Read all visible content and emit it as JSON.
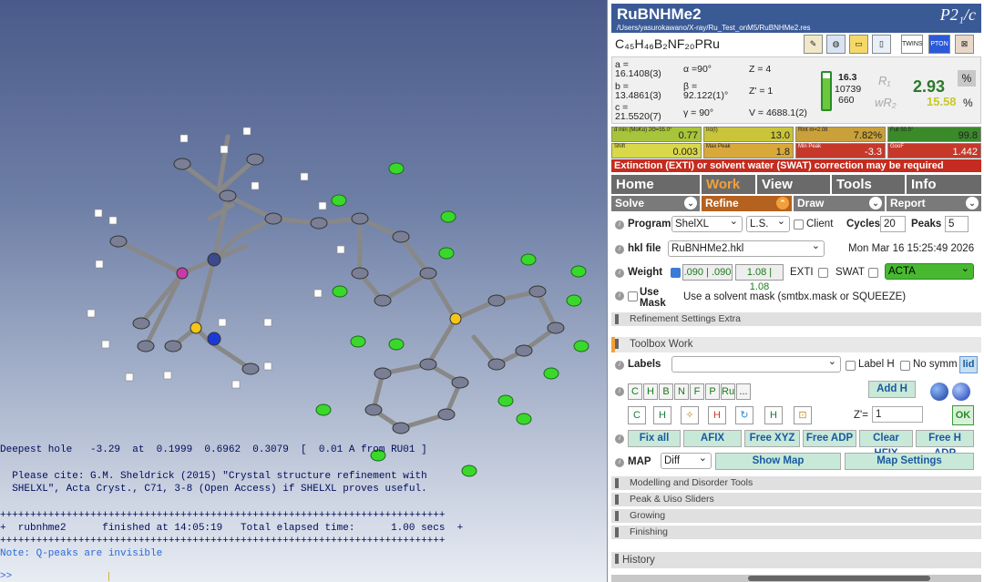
{
  "console": {
    "deepest": "Deepest hole   -3.29  at  0.1999  0.6962  0.3079  [  0.01 A from RU01 ]",
    "cite1": "  Please cite: G.M. Sheldrick (2015) \"Crystal structure refinement with",
    "cite2": "  SHELXL\", Acta Cryst., C71, 3-8 (Open Access) if SHELXL proves useful.",
    "plus1": "++++++++++++++++++++++++++++++++++++++++++++++++++++++++++++++++++++++++++",
    "finish": "+  rubnhme2      finished at 14:05:19   Total elapsed time:      1.00 secs  +",
    "plus2": "++++++++++++++++++++++++++++++++++++++++++++++++++++++++++++++++++++++++++",
    "note": "Note: Q-peaks are invisible",
    "prompt": ">>"
  },
  "header": {
    "title": "RuBNHMe2",
    "path": "/Users/yasurokawano/X-ray/Ru_Test_onM5/RuBNHMe2.res",
    "spacegroup": "P2₁/c"
  },
  "formula": "C₄₅H₄₆B₂NF₂₀PRu",
  "toolbar_icons": [
    "pencil-icon",
    "globe-icon",
    "folder-icon",
    "notebook-icon",
    "twins-icon",
    "pton-icon",
    "collapse-icon"
  ],
  "toolbar_labels": {
    "twins": "TWINS",
    "pton": "PTON"
  },
  "cell": {
    "a_l": "a =",
    "a_v": "16.1408(3)",
    "b_l": "b =",
    "b_v": "13.4861(3)",
    "c_l": "c =",
    "c_v": "21.5520(7)",
    "alpha": "α =90°",
    "beta_l": "β =",
    "beta_v": "92.122(1)°",
    "gamma": "γ = 90°",
    "z": "Z = 4",
    "zp": "Z' = 1",
    "v": "V = 4688.1(2)"
  },
  "refl": {
    "r1": "16.3",
    "r2": "10739",
    "r3": "660"
  },
  "r1": {
    "label": "R₁",
    "value": "2.93",
    "pct": "%"
  },
  "wr2": {
    "label": "wR₂",
    "value": "15.58",
    "pct": "%"
  },
  "stats": [
    {
      "label": "d min (MoKα) 2Θ=55.0°",
      "value": "0.77",
      "color": "#a8c43a"
    },
    {
      "label": "I/σ(I)",
      "value": "13.0",
      "color": "#c9c43a"
    },
    {
      "label": "Rint m=2.08",
      "value": "7.82%",
      "color": "#c9a03a"
    },
    {
      "label": "Full 50.5°",
      "value": "99.8",
      "color": "#3a8a2a"
    },
    {
      "label": "Shift",
      "value": "0.003",
      "color": "#d8d84a"
    },
    {
      "label": "Max Peak",
      "value": "1.8",
      "color": "#d8a83a"
    },
    {
      "label": "Min Peak",
      "value": "-3.3",
      "color": "#c5382a"
    },
    {
      "label": "GooF",
      "value": "1.442",
      "color": "#c5382a"
    }
  ],
  "warning": "Extinction (EXTI) or solvent water (SWAT) correction may be required",
  "tabs": [
    "Home",
    "Work",
    "View",
    "Tools",
    "Info"
  ],
  "subtabs": [
    "Solve",
    "Refine",
    "Draw",
    "Report"
  ],
  "program": {
    "label": "Program",
    "value": "ShelXL",
    "method": "L.S.",
    "client": "Client",
    "cycles_l": "Cycles",
    "cycles": "20",
    "peaks_l": "Peaks",
    "peaks": "5"
  },
  "hkl": {
    "label": "hkl file",
    "value": "RuBNHMe2.hkl",
    "date": "Mon Mar 16 15:25:49 2026"
  },
  "weight": {
    "label": "Weight",
    "w1": ".090 | .090",
    "w2": "1.08 | 1.08",
    "exti": "EXTI",
    "swat": "SWAT",
    "acta": "ACTA"
  },
  "mask": {
    "label1": "Use",
    "label2": "Mask",
    "desc": "Use a solvent mask (smtbx.mask or SQUEEZE)"
  },
  "extra": "Refinement Settings Extra",
  "toolbox": "Toolbox Work",
  "labels": {
    "label": "Labels",
    "labelh": "Label H",
    "nosymm": "No symm",
    "lid": "lid"
  },
  "elements": [
    "C",
    "H",
    "B",
    "N",
    "F",
    "P",
    "Ru",
    "..."
  ],
  "addh": "Add H",
  "zprime": {
    "label": "Z'=",
    "value": "1"
  },
  "buttons": [
    "Fix all",
    "AFIX",
    "Free XYZ",
    "Free ADP",
    "Clear HFIX",
    "Free H ADP"
  ],
  "map": {
    "label": "MAP",
    "value": "Diff",
    "show": "Show Map",
    "settings": "Map Settings"
  },
  "sections": [
    "Modelling and Disorder Tools",
    "Peak & Uiso Sliders",
    "Growing",
    "Finishing"
  ],
  "history": "History"
}
